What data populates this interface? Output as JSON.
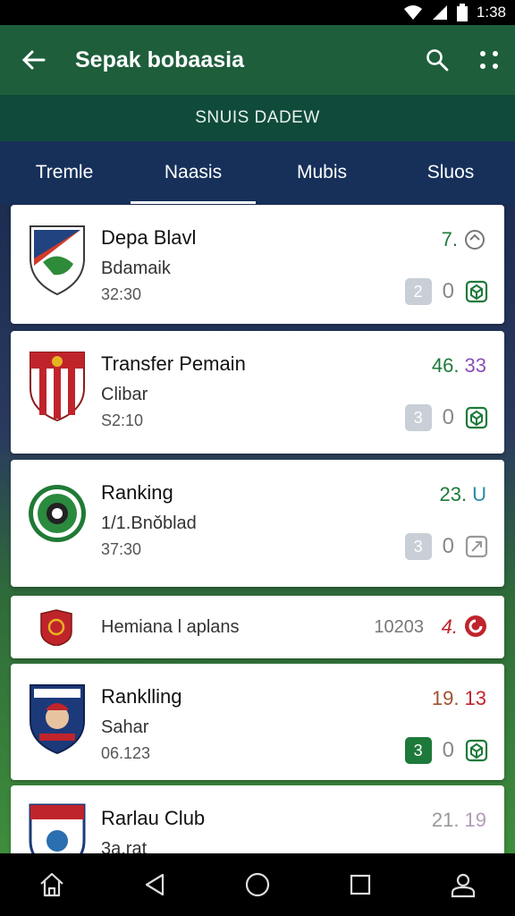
{
  "status": {
    "time": "1:38"
  },
  "appbar": {
    "title": "Sepak bobaasia"
  },
  "subbar": {
    "label": "SNUIS DADEW"
  },
  "tabs": [
    {
      "label": "Tremle"
    },
    {
      "label": "Naasis"
    },
    {
      "label": "Mubis"
    },
    {
      "label": "Sluos"
    }
  ],
  "cards": [
    {
      "name": "Depa Blavl",
      "sub": "Bdamaik",
      "time": "32:30",
      "score_a": "7.",
      "score_b": "",
      "badge": "2",
      "zero": "0"
    },
    {
      "name": "Transfer Pemain",
      "sub": "Clibar",
      "time": "S2:10",
      "score_a": "46.",
      "score_b": "33",
      "badge": "3",
      "zero": "0"
    },
    {
      "name": "Ranking",
      "sub": "1/1.Bnǒblad",
      "time": "37:30",
      "score_a": "23.",
      "score_b": "U",
      "badge": "3",
      "zero": "0"
    },
    {
      "name": "Hemiana l aplans",
      "value": "10203",
      "score_a": "4."
    },
    {
      "name": "Ranklling",
      "sub": "Sahar",
      "time": "06.123",
      "score_a": "19.",
      "score_b": "13",
      "badge": "3",
      "zero": "0"
    },
    {
      "name": "Rarlau Club",
      "sub": "3a.rat",
      "score_a": "21.",
      "score_b": "19"
    }
  ],
  "colors": {
    "green_score": "#1d7a3a",
    "purple_score": "#8a4fb8",
    "teal_score": "#2a8aa6",
    "red_score": "#c0242b",
    "brown_score": "#a0522d",
    "grey_score": "#999999"
  },
  "icons": [
    "back-arrow-icon",
    "search-icon",
    "more-icon",
    "home-icon",
    "back-nav-icon",
    "circle-nav-icon",
    "square-nav-icon",
    "person-icon"
  ]
}
